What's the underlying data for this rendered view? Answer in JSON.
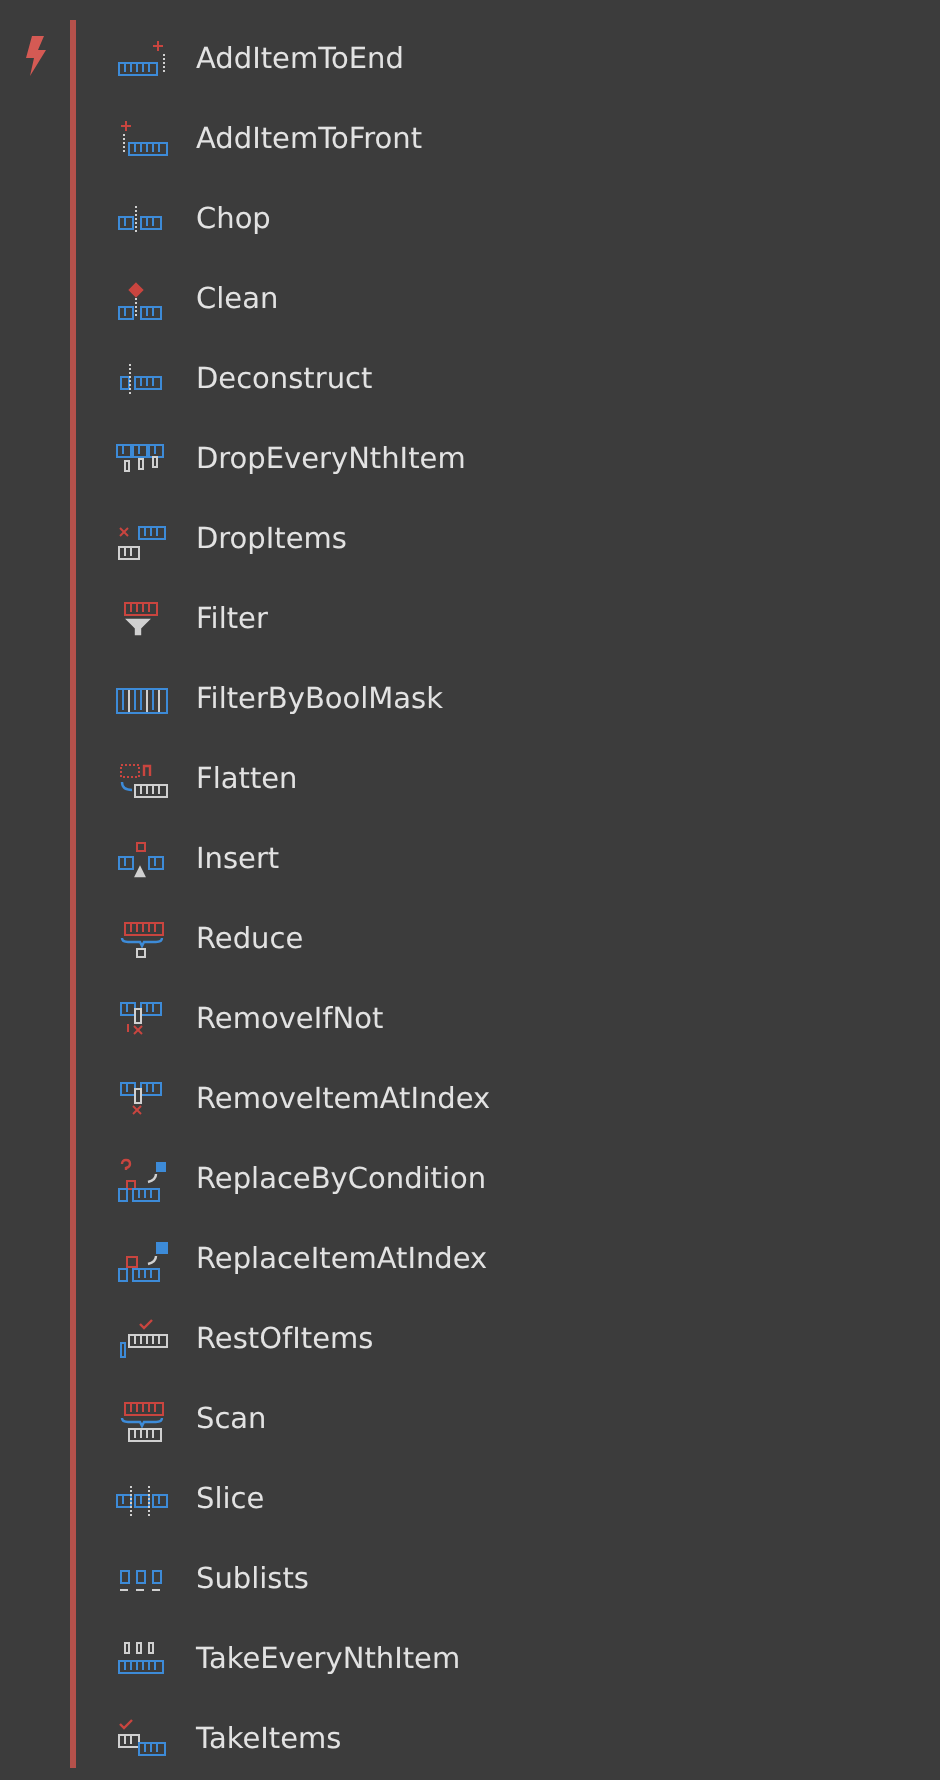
{
  "items": [
    {
      "label": "AddItemToEnd"
    },
    {
      "label": "AddItemToFront"
    },
    {
      "label": "Chop"
    },
    {
      "label": "Clean"
    },
    {
      "label": "Deconstruct"
    },
    {
      "label": "DropEveryNthItem"
    },
    {
      "label": "DropItems"
    },
    {
      "label": "Filter"
    },
    {
      "label": "FilterByBoolMask"
    },
    {
      "label": "Flatten"
    },
    {
      "label": "Insert"
    },
    {
      "label": "Reduce"
    },
    {
      "label": "RemoveIfNot"
    },
    {
      "label": "RemoveItemAtIndex"
    },
    {
      "label": "ReplaceByCondition"
    },
    {
      "label": "ReplaceItemAtIndex"
    },
    {
      "label": "RestOfItems"
    },
    {
      "label": "Scan"
    },
    {
      "label": "Slice"
    },
    {
      "label": "Sublists"
    },
    {
      "label": "TakeEveryNthItem"
    },
    {
      "label": "TakeItems"
    }
  ]
}
